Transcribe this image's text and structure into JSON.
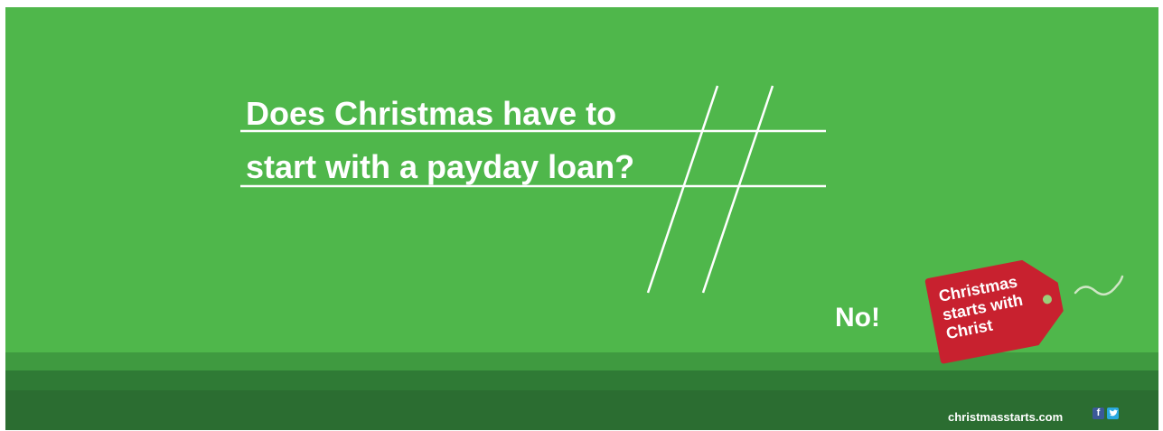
{
  "headline": {
    "line1": "Does Christmas have to",
    "line2": "start with a payday loan?"
  },
  "answer": "No!",
  "tag": {
    "line1": "Christmas",
    "line2": "starts with",
    "line3": "Christ"
  },
  "footer": {
    "url": "christmasstarts.com",
    "social_icons": [
      "facebook-icon",
      "twitter-icon"
    ]
  },
  "colors": {
    "background": "#4fb74b",
    "tag": "#c8212f",
    "footer": "#2b6d31",
    "text": "#ffffff"
  }
}
